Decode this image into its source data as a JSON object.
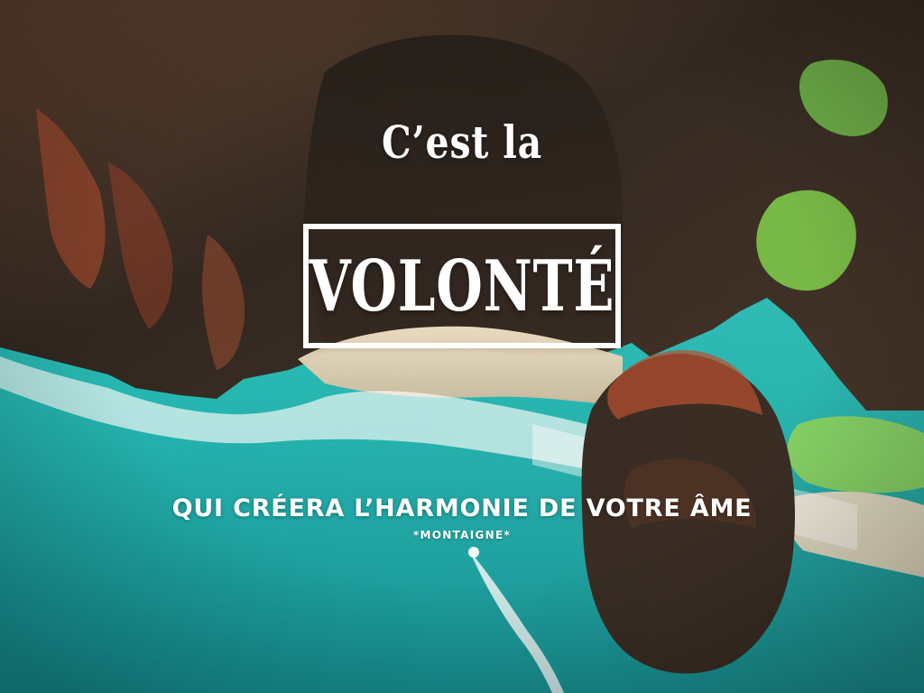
{
  "quote": {
    "line1": "C’est la",
    "emphasis": "VOLONTÉ",
    "line2": "QUI CRÉERA L’HARMONIE DE VOTRE ÂME",
    "author": "*MONTAIGNE*"
  },
  "image": {
    "subject": "aerial coastal cliff with turquoise sea",
    "colors": {
      "sea": "#1ec0b7",
      "rock": "#3a2b22",
      "cliff_red": "#b84a2b",
      "vegetation": "#7ccf4c",
      "sand": "#e8dcc5",
      "text": "#ffffff"
    }
  }
}
